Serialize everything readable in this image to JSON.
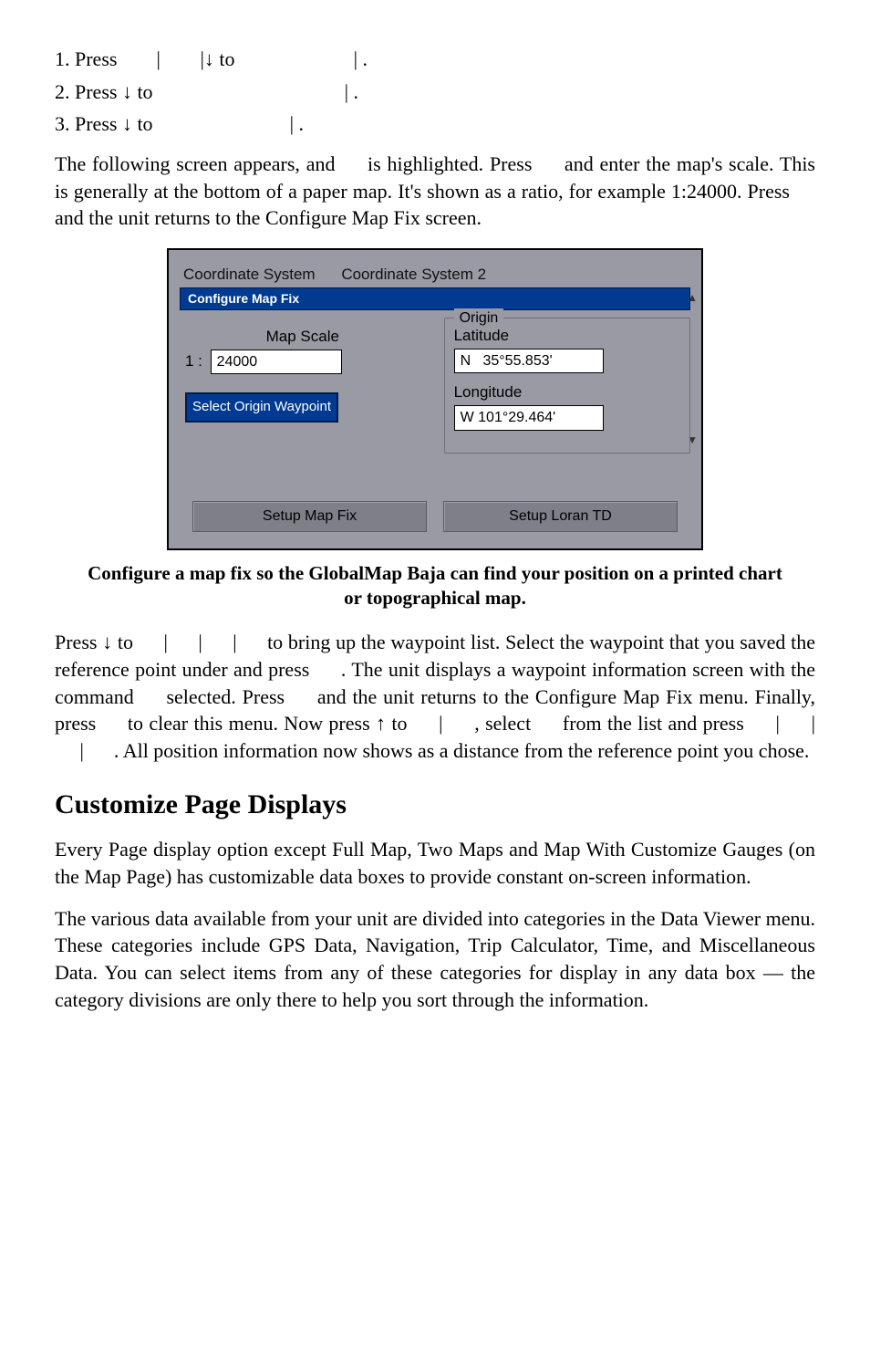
{
  "steps": {
    "s1a": "1. Press ",
    "s1b": "|",
    "s1c": "|↓ to ",
    "s1d": "| .",
    "s2": "2. Press ↓ to ",
    "s2b": "| .",
    "s3": "3. Press ↓ to ",
    "s3b": "| ."
  },
  "para1": "The following screen appears, and   is highlighted. Press   and enter the map's scale. This is generally at the bottom of a paper map. It's shown as a ratio, for example 1:24000. Press   and the unit returns to the Configure Map Fix screen.",
  "dialog": {
    "tab1": "Coordinate System",
    "tab2": "Coordinate System 2",
    "strip": "Configure Map Fix",
    "map_scale_label": "Map Scale",
    "scale_prefix": "1 :",
    "scale_value": "24000",
    "origin_btn": "Select Origin Waypoint",
    "origin_group": "Origin",
    "lat_label": "Latitude",
    "lat_value": "N   35°55.853'",
    "lon_label": "Longitude",
    "lon_value": "W 101°29.464'",
    "btn_left": "Setup Map Fix",
    "btn_right": "Setup Loran TD"
  },
  "caption": "Configure a map fix so the GlobalMap Baja can find your position on a printed chart or topographical map.",
  "para2": "Press ↓ to   |   |   |   to bring up the waypoint list. Select the waypoint that you saved the reference point under and press   . The unit displays a waypoint information screen with the command   selected. Press   and the unit returns to the Configure Map Fix menu. Finally, press   to clear this menu. Now press ↑ to   |   , select   from the list and press   |   |   |   . All position information now shows as a distance from the reference point you chose.",
  "section_title": "Customize Page Displays",
  "para3": "Every Page display option except Full Map, Two Maps and Map With Customize Gauges (on the Map Page) has customizable data boxes to provide constant on-screen information.",
  "para4": "The various data available from your unit are divided into categories in the Data Viewer menu. These categories include GPS Data, Navigation, Trip Calculator, Time, and Miscellaneous Data. You can select items from any of these categories for display in any data box — the category divisions are only there to help you sort through the information."
}
